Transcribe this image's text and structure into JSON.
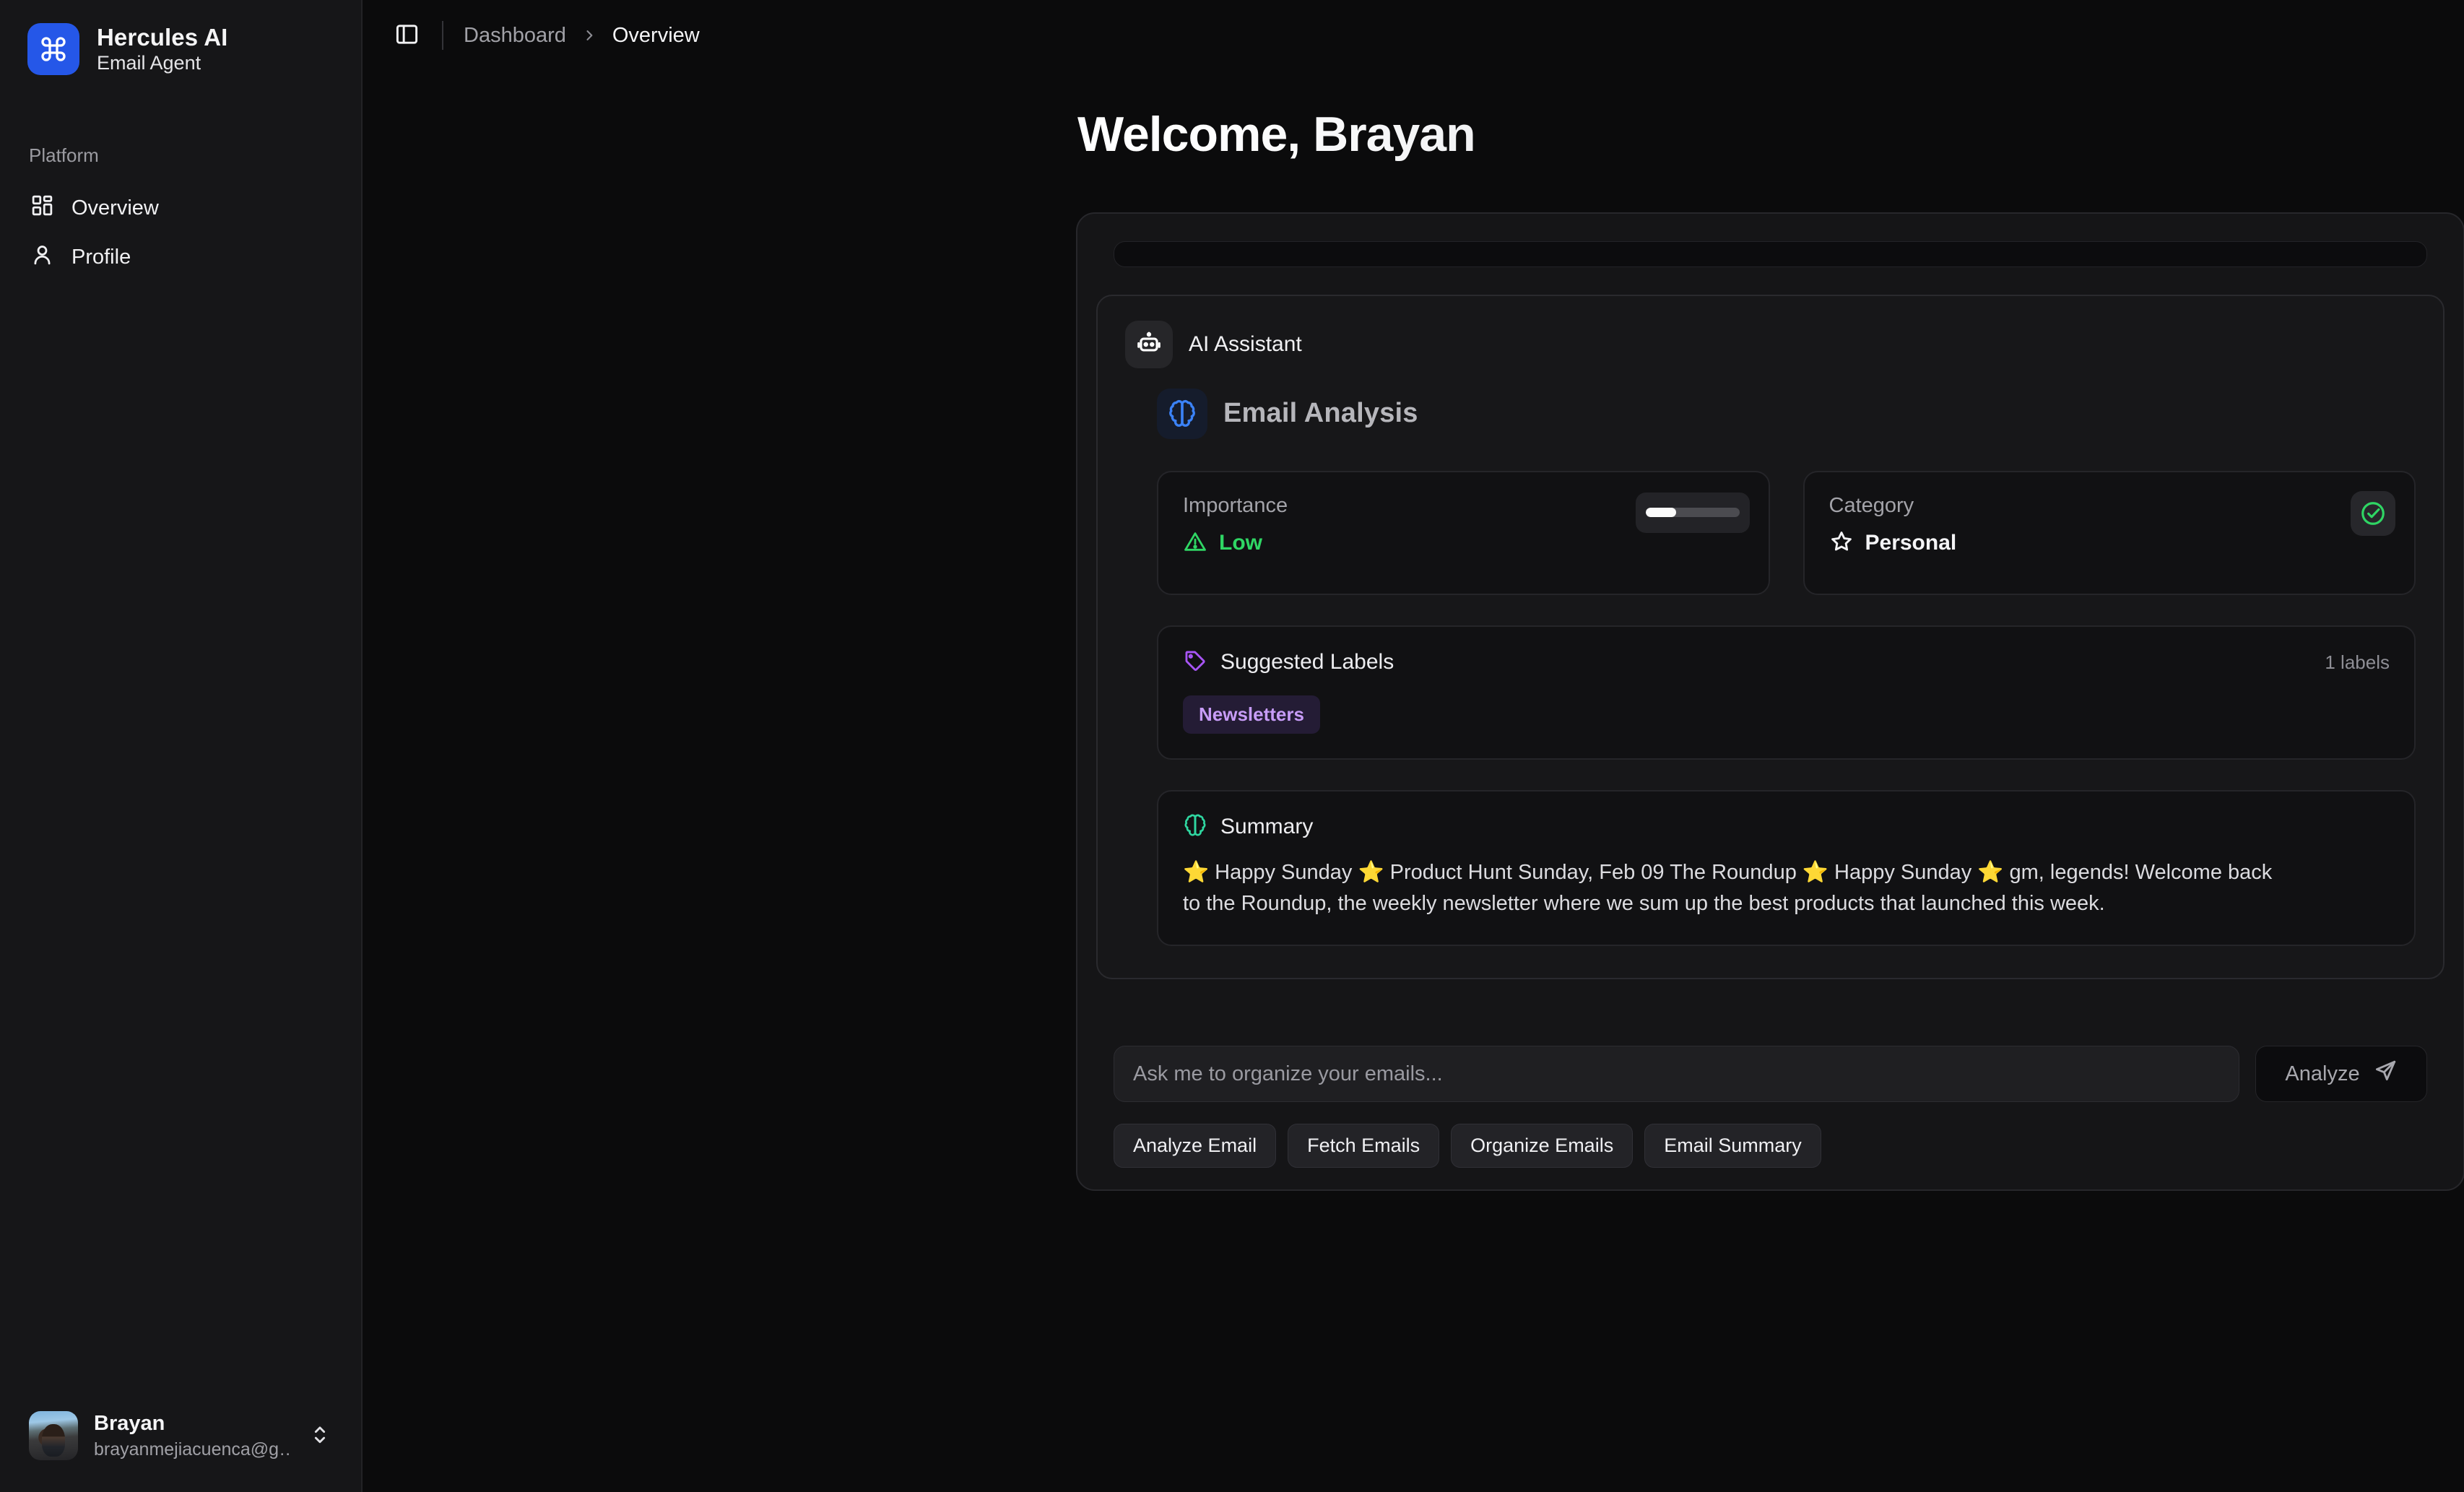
{
  "sidebar": {
    "brand": {
      "title": "Hercules AI",
      "subtitle": "Email Agent",
      "logo_icon": "command-icon"
    },
    "group_label": "Platform",
    "items": [
      {
        "label": "Overview",
        "icon": "layout-dashboard-icon"
      },
      {
        "label": "Profile",
        "icon": "user-icon"
      }
    ],
    "user": {
      "name": "Brayan",
      "email": "brayanmejiacuenca@g…",
      "chevrons_icon": "chevrons-up-down-icon",
      "avatar_icon": "avatar"
    }
  },
  "topbar": {
    "sidebar_toggle_icon": "panel-left-icon",
    "breadcrumbs": [
      {
        "label": "Dashboard",
        "current": false
      },
      {
        "label": "Overview",
        "current": true
      }
    ],
    "separator_icon": "chevron-right-icon"
  },
  "main": {
    "welcome_heading": "Welcome, Brayan",
    "assistant": {
      "badge_icon": "bot-icon",
      "name": "AI Assistant",
      "analysis": {
        "icon": "brain-icon",
        "title": "Email Analysis",
        "metrics": [
          {
            "label": "Importance",
            "value": "Low",
            "value_icon": "alert-triangle-icon",
            "value_color": "#2fd664",
            "meter_percent": 33
          },
          {
            "label": "Category",
            "value": "Personal",
            "value_icon": "star-icon",
            "value_color": "#f4f4f6",
            "badge_icon": "check-circle-icon",
            "badge_color": "#2fd664"
          }
        ],
        "labels": {
          "icon": "tag-icon",
          "title": "Suggested Labels",
          "count_text": "1 labels",
          "chips": [
            "Newsletters"
          ],
          "chip_color": "#c79cf7"
        },
        "summary": {
          "icon": "brain-icon",
          "title": "Summary",
          "text": "⭐ Happy Sunday ⭐ Product Hunt Sunday, Feb 09 The Roundup ⭐ Happy Sunday ⭐ gm, legends! Welcome back to the Roundup, the weekly newsletter where we sum up the best products that launched this week."
        }
      }
    },
    "composer": {
      "placeholder": "Ask me to organize your emails...",
      "value": "",
      "submit_label": "Analyze",
      "submit_icon": "send-icon"
    },
    "quick_actions": [
      {
        "label": "Analyze Email"
      },
      {
        "label": "Fetch Emails"
      },
      {
        "label": "Organize Emails"
      },
      {
        "label": "Email Summary"
      }
    ]
  },
  "colors": {
    "brand_blue": "#2557e8",
    "accent_blue": "#3b82f6",
    "success_green": "#2fd664",
    "label_purple": "#c79cf7",
    "sidebar_bg": "#161618",
    "main_bg": "#0b0b0c"
  }
}
